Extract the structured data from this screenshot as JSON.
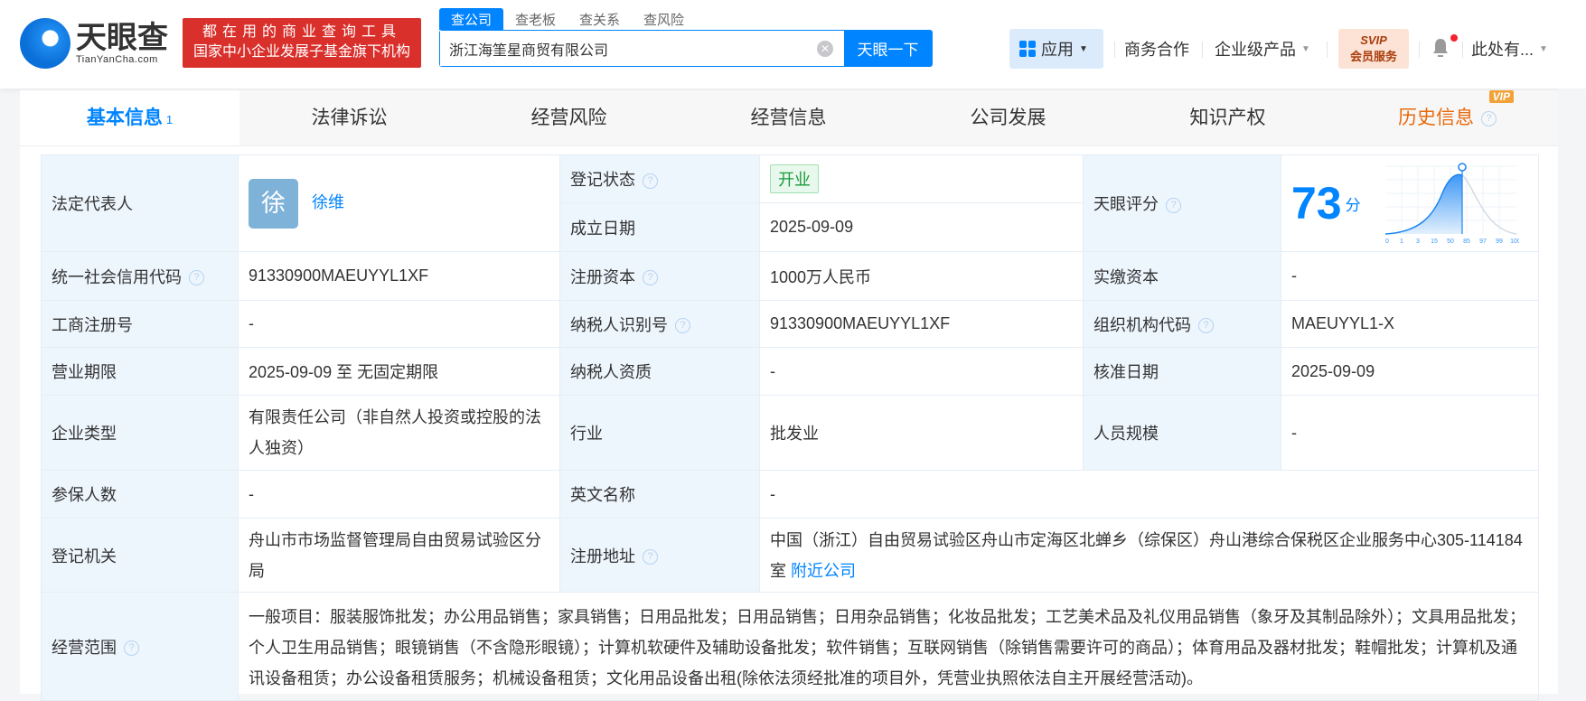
{
  "header": {
    "logo_cn": "天眼查",
    "logo_en": "TianYanCha.com",
    "slogan_line1": "都在用的商业查询工具",
    "slogan_line2": "国家中小企业发展子基金旗下机构",
    "search_tabs": [
      "查公司",
      "查老板",
      "查关系",
      "查风险"
    ],
    "search_value": "浙江海筀星商贸有限公司",
    "search_button": "天眼一下",
    "nav": {
      "apps": "应用",
      "business": "商务合作",
      "enterprise": "企业级产品",
      "svip_top": "SVIP",
      "svip_bottom": "会员服务",
      "user": "此处有..."
    }
  },
  "tabs": [
    {
      "label": "基本信息",
      "count": "1"
    },
    {
      "label": "法律诉讼"
    },
    {
      "label": "经营风险"
    },
    {
      "label": "经营信息"
    },
    {
      "label": "公司发展"
    },
    {
      "label": "知识产权"
    },
    {
      "label": "历史信息",
      "badge": "VIP"
    }
  ],
  "info": {
    "legal_rep_label": "法定代表人",
    "legal_rep_avatar": "徐",
    "legal_rep": "徐维",
    "status_label": "登记状态",
    "status": "开业",
    "founded_label": "成立日期",
    "founded": "2025-09-09",
    "score_label": "天眼评分",
    "score": "73",
    "score_unit": "分",
    "score_axis": [
      "0",
      "1",
      "3",
      "15",
      "50",
      "85",
      "97",
      "99",
      "100"
    ],
    "credit_code_label": "统一社会信用代码",
    "credit_code": "91330900MAEUYYL1XF",
    "reg_capital_label": "注册资本",
    "reg_capital": "1000万人民币",
    "paid_capital_label": "实缴资本",
    "paid_capital": "-",
    "biz_reg_no_label": "工商注册号",
    "biz_reg_no": "-",
    "taxpayer_id_label": "纳税人识别号",
    "taxpayer_id": "91330900MAEUYYL1XF",
    "org_code_label": "组织机构代码",
    "org_code": "MAEUYYL1-X",
    "term_label": "营业期限",
    "term": "2025-09-09 至 无固定期限",
    "tax_qual_label": "纳税人资质",
    "tax_qual": "-",
    "approval_label": "核准日期",
    "approval": "2025-09-09",
    "type_label": "企业类型",
    "type": "有限责任公司（非自然人投资或控股的法人独资）",
    "industry_label": "行业",
    "industry": "批发业",
    "staff_label": "人员规模",
    "staff": "-",
    "insured_label": "参保人数",
    "insured": "-",
    "en_name_label": "英文名称",
    "en_name": "-",
    "authority_label": "登记机关",
    "authority": "舟山市市场监督管理局自由贸易试验区分局",
    "address_label": "注册地址",
    "address": "中国（浙江）自由贸易试验区舟山市定海区北蝉乡（综保区）舟山港综合保税区企业服务中心305-114184室",
    "nearby": "附近公司",
    "scope_label": "经营范围",
    "scope": "一般项目：服装服饰批发；办公用品销售；家具销售；日用品批发；日用品销售；日用杂品销售；化妆品批发；工艺美术品及礼仪用品销售（象牙及其制品除外）；文具用品批发；个人卫生用品销售；眼镜销售（不含隐形眼镜）；计算机软硬件及辅助设备批发；软件销售；互联网销售（除销售需要许可的商品）；体育用品及器材批发；鞋帽批发；计算机及通讯设备租赁；办公设备租赁服务；机械设备租赁；文化用品设备出租(除依法须经批准的项目外，凭营业执照依法自主开展经营活动)。"
  },
  "colors": {
    "accent": "#0084ff",
    "history": "#e86a0c",
    "label_bg": "#edf5fd"
  }
}
